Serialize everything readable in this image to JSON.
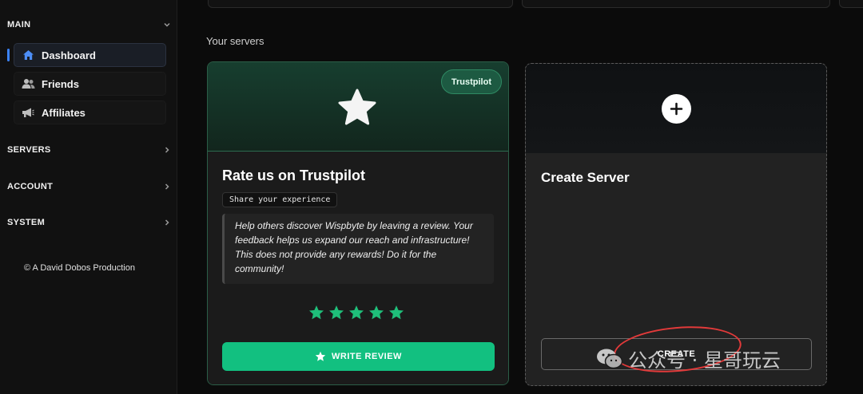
{
  "sidebar": {
    "main_section": "MAIN",
    "items": [
      {
        "label": "Dashboard",
        "icon": "home-icon",
        "active": true
      },
      {
        "label": "Friends",
        "icon": "users-icon"
      },
      {
        "label": "Affiliates",
        "icon": "megaphone-icon"
      }
    ],
    "servers_section": "SERVERS",
    "account_section": "ACCOUNT",
    "system_section": "SYSTEM",
    "footer": "© A David Dobos Production"
  },
  "main": {
    "section_title": "Your servers",
    "trustpilot_card": {
      "badge": "Trustpilot",
      "title": "Rate us on Trustpilot",
      "subtitle": "Share your experience",
      "quote": "Help others discover Wispbyte by leaving a review. Your feedback helps us expand our reach and infrastructure! This does not provide any rewards! Do it for the community!",
      "rating_stars": 5,
      "button_label": "WRITE REVIEW"
    },
    "create_card": {
      "title": "Create Server",
      "button_label": "CREATE"
    }
  },
  "watermark": "公众号 · 星哥玩云",
  "colors": {
    "accent_green": "#12c080",
    "star_green": "#1fbf7a",
    "active_blue": "#3b82f6",
    "annotation_red": "#e23a3a"
  }
}
